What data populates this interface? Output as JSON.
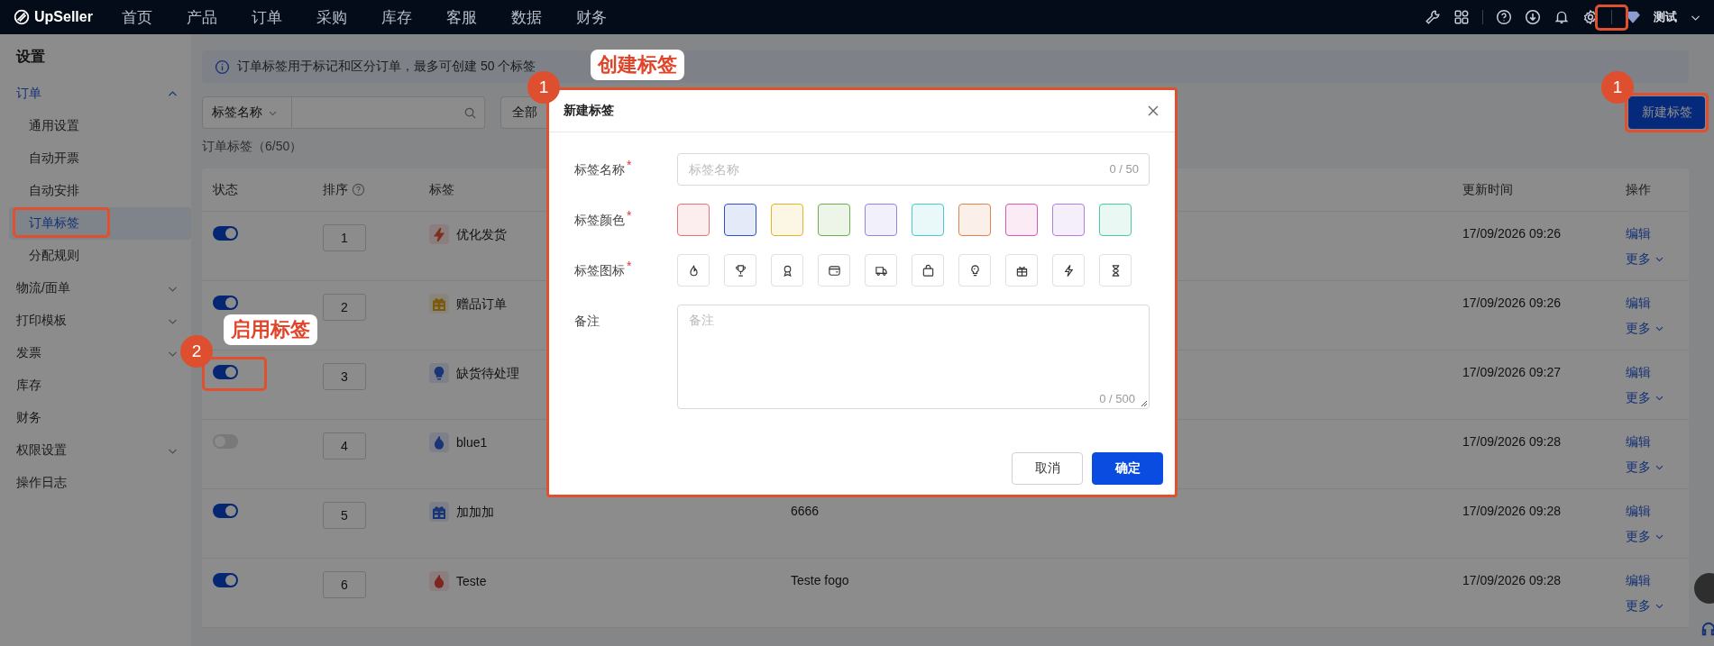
{
  "topbar": {
    "logo": "UpSeller",
    "nav": [
      "首页",
      "产品",
      "订单",
      "采购",
      "库存",
      "客服",
      "数据",
      "财务"
    ],
    "user": "测试"
  },
  "sidebar": {
    "title": "设置",
    "items": [
      {
        "label": "订单",
        "kind": "group",
        "selected": true,
        "expanded": true,
        "children": [
          {
            "label": "通用设置",
            "selected": false
          },
          {
            "label": "自动开票",
            "selected": false
          },
          {
            "label": "自动安排",
            "selected": false
          },
          {
            "label": "订单标签",
            "selected": true
          },
          {
            "label": "分配规则",
            "selected": false
          }
        ]
      },
      {
        "label": "物流/面单",
        "kind": "group",
        "selected": false,
        "expanded": false
      },
      {
        "label": "打印模板",
        "kind": "group",
        "selected": false,
        "expanded": false
      },
      {
        "label": "发票",
        "kind": "group",
        "selected": false,
        "expanded": false
      },
      {
        "label": "库存",
        "kind": "link",
        "selected": false
      },
      {
        "label": "财务",
        "kind": "link",
        "selected": false
      },
      {
        "label": "权限设置",
        "kind": "group",
        "selected": false,
        "expanded": false
      },
      {
        "label": "操作日志",
        "kind": "link",
        "selected": false
      }
    ]
  },
  "banner": {
    "text": "订单标签用于标记和区分订单，最多可创建 50 个标签"
  },
  "filter": {
    "field": "标签名称",
    "status": "全部"
  },
  "new_button": "新建标签",
  "count": "订单标签（6/50）",
  "table": {
    "columns": {
      "status": "状态",
      "order": "排序",
      "tag": "标签",
      "updated": "更新时间",
      "actions": "操作"
    },
    "rows": [
      {
        "enabled": true,
        "order": "1",
        "tag": "优化发货",
        "kind": "bolt",
        "color": "#7e2f20",
        "updated": "17/09/2026 09:26",
        "edit": "编辑",
        "more": "更多"
      },
      {
        "enabled": true,
        "order": "2",
        "tag": "赠品订单",
        "kind": "gift",
        "color": "#7b590e",
        "updated": "17/09/2026 09:26",
        "edit": "编辑",
        "more": "更多"
      },
      {
        "enabled": true,
        "order": "3",
        "tag": "缺货待处理",
        "kind": "bulb",
        "color": "#193675",
        "updated": "17/09/2026 09:27",
        "edit": "编辑",
        "more": "更多"
      },
      {
        "enabled": false,
        "order": "4",
        "tag": "blue1",
        "kind": "flame",
        "color": "#193675",
        "updated": "17/09/2026 09:28",
        "edit": "编辑",
        "more": "更多"
      },
      {
        "enabled": true,
        "order": "5",
        "tag": "加加加",
        "kind": "gift",
        "color": "#193675",
        "remark": "6666",
        "updated": "17/09/2026 09:28",
        "edit": "编辑",
        "more": "更多"
      },
      {
        "enabled": true,
        "order": "6",
        "tag": "Teste",
        "kind": "flame",
        "color": "#7e2620",
        "remark": "Teste fogo",
        "updated": "17/09/2026 09:28",
        "edit": "编辑",
        "more": "更多"
      }
    ]
  },
  "modal": {
    "title": "新建标签",
    "fields": [
      {
        "kind": "text",
        "label": "标签名称",
        "required": "*",
        "placeholder": "标签名称",
        "count": "0 / 50"
      },
      {
        "kind": "colors",
        "label": "标签颜色",
        "required": "*",
        "options": [
          {
            "color": "#e57373"
          },
          {
            "color": "#2952c4"
          },
          {
            "color": "#e6b422"
          },
          {
            "color": "#6ab04c"
          },
          {
            "color": "#8e86e0"
          },
          {
            "color": "#4cc6d0"
          },
          {
            "color": "#e0804a"
          },
          {
            "color": "#d45bb0"
          },
          {
            "color": "#b07fdc"
          },
          {
            "color": "#4cc9a0"
          }
        ]
      },
      {
        "kind": "icons",
        "label": "标签图标",
        "required": "*",
        "options": [
          {
            "kind": "flame"
          },
          {
            "kind": "trophy"
          },
          {
            "kind": "award"
          },
          {
            "kind": "wallet"
          },
          {
            "kind": "truck"
          },
          {
            "kind": "bag"
          },
          {
            "kind": "bulb"
          },
          {
            "kind": "gift"
          },
          {
            "kind": "bolt"
          },
          {
            "kind": "hourglass"
          }
        ]
      },
      {
        "kind": "textarea",
        "label": "备注",
        "placeholder": "备注",
        "count": "0 / 500"
      }
    ],
    "cancel": "取消",
    "ok": "确定"
  },
  "annotations": {
    "callouts": [
      "创建标签",
      "启用标签"
    ],
    "badges": [
      "1",
      "1",
      "2"
    ]
  }
}
